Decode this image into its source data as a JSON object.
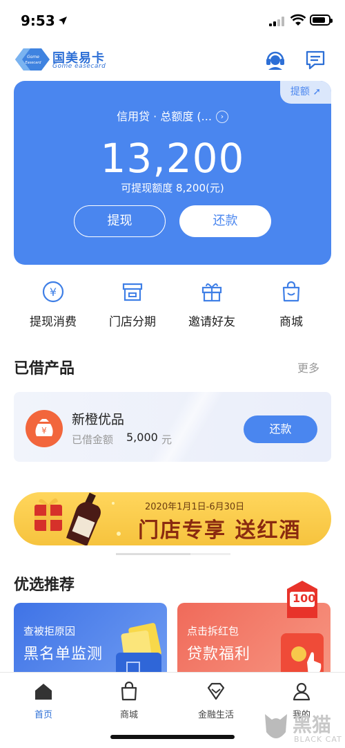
{
  "status_bar": {
    "time": "9:53"
  },
  "header": {
    "logo_cn": "国美易卡",
    "logo_en": "Gome easecard",
    "logo_mark_text": "Gome Easecard",
    "service_icon": "headset-icon",
    "message_icon": "message-icon"
  },
  "credit_card": {
    "badge": "提额",
    "title": "信用贷 · 总额度 (...",
    "amount": "13,200",
    "available": "可提现额度 8,200(元)",
    "withdraw_button": "提现",
    "repay_button": "还款",
    "accent_color": "#4a86ef"
  },
  "quick_actions": [
    {
      "label": "提现消费",
      "icon": "yen-coin-icon"
    },
    {
      "label": "门店分期",
      "icon": "store-icon"
    },
    {
      "label": "邀请好友",
      "icon": "gift-icon"
    },
    {
      "label": "商城",
      "icon": "shopping-bag-icon"
    }
  ],
  "borrowed": {
    "title": "已借产品",
    "more": "更多",
    "product": {
      "name": "新橙优品",
      "amount_label": "已借金额",
      "amount": "5,000",
      "unit": "元",
      "repay_button": "还款"
    }
  },
  "banner": {
    "date": "2020年1月1日-6月30日",
    "headline": "门店专享 送红酒"
  },
  "recommend": {
    "title": "优选推荐",
    "cards": [
      {
        "small": "查被拒原因",
        "big": "黑名单监测"
      },
      {
        "small": "点击拆红包",
        "big": "贷款福利",
        "badge": "100"
      }
    ]
  },
  "tab_bar": [
    {
      "label": "首页",
      "icon": "home-icon",
      "active": true
    },
    {
      "label": "商城",
      "icon": "shopping-bag-icon"
    },
    {
      "label": "金融生活",
      "icon": "diamond-icon"
    },
    {
      "label": "我的",
      "icon": "person-icon"
    }
  ],
  "watermark": {
    "cn": "黑猫",
    "en": "BLACK CAT"
  }
}
